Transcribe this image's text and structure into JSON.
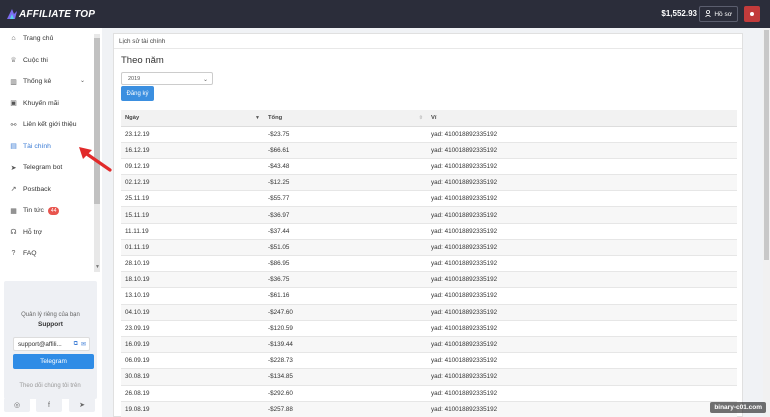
{
  "app": {
    "logo_text": "AFFILIATE TOP",
    "balance": "$1,552.93",
    "profile_label": "Hồ sơ",
    "brand_color": "#2b2d3a",
    "accent_color": "#3a7bd5",
    "danger_color": "#c23b3b"
  },
  "sidebar": {
    "items": [
      {
        "label": "Trang chủ",
        "icon": "home-icon"
      },
      {
        "label": "Cuộc thi",
        "icon": "trophy-icon"
      },
      {
        "label": "Thống kê",
        "icon": "chart-icon"
      },
      {
        "label": "Khuyến mãi",
        "icon": "promo-icon"
      },
      {
        "label": "Liên kết giới thiệu",
        "icon": "link-icon"
      },
      {
        "label": "Tài chính",
        "icon": "finance-icon",
        "active": true
      },
      {
        "label": "Telegram bot",
        "icon": "telegram-icon"
      },
      {
        "label": "Postback",
        "icon": "postback-icon"
      },
      {
        "label": "Tin tức",
        "icon": "news-icon",
        "badge": "44"
      },
      {
        "label": "Hỗ trợ",
        "icon": "headset-icon"
      },
      {
        "label": "FAQ",
        "icon": "question-icon"
      }
    ],
    "support": {
      "title": "Quản lý riêng của bạn",
      "subtitle": "Support",
      "email": "support@affili...",
      "telegram_label": "Telegram",
      "follow_text": "Theo dõi chúng tôi trên"
    }
  },
  "main": {
    "breadcrumb": "Lịch sử tài chính",
    "section_title": "Theo năm",
    "year_selected": "2019",
    "register_label": "Đăng ký",
    "table": {
      "headers": [
        "Ngày",
        "Tổng",
        "Ví"
      ],
      "rows": [
        [
          "23.12.19",
          "-$23.75",
          "yad: 410018892335192"
        ],
        [
          "16.12.19",
          "-$66.61",
          "yad: 410018892335192"
        ],
        [
          "09.12.19",
          "-$43.48",
          "yad: 410018892335192"
        ],
        [
          "02.12.19",
          "-$12.25",
          "yad: 410018892335192"
        ],
        [
          "25.11.19",
          "-$55.77",
          "yad: 410018892335192"
        ],
        [
          "15.11.19",
          "-$36.97",
          "yad: 410018892335192"
        ],
        [
          "11.11.19",
          "-$37.44",
          "yad: 410018892335192"
        ],
        [
          "01.11.19",
          "-$51.05",
          "yad: 410018892335192"
        ],
        [
          "28.10.19",
          "-$86.95",
          "yad: 410018892335192"
        ],
        [
          "18.10.19",
          "-$36.75",
          "yad: 410018892335192"
        ],
        [
          "13.10.19",
          "-$61.16",
          "yad: 410018892335192"
        ],
        [
          "04.10.19",
          "-$247.60",
          "yad: 410018892335192"
        ],
        [
          "23.09.19",
          "-$120.59",
          "yad: 410018892335192"
        ],
        [
          "16.09.19",
          "-$139.44",
          "yad: 410018892335192"
        ],
        [
          "06.09.19",
          "-$228.73",
          "yad: 410018892335192"
        ],
        [
          "30.08.19",
          "-$134.85",
          "yad: 410018892335192"
        ],
        [
          "26.08.19",
          "-$292.60",
          "yad: 410018892335192"
        ],
        [
          "19.08.19",
          "-$257.88",
          "yad: 410018892335192"
        ]
      ]
    }
  },
  "watermark": "binary-c01.com"
}
